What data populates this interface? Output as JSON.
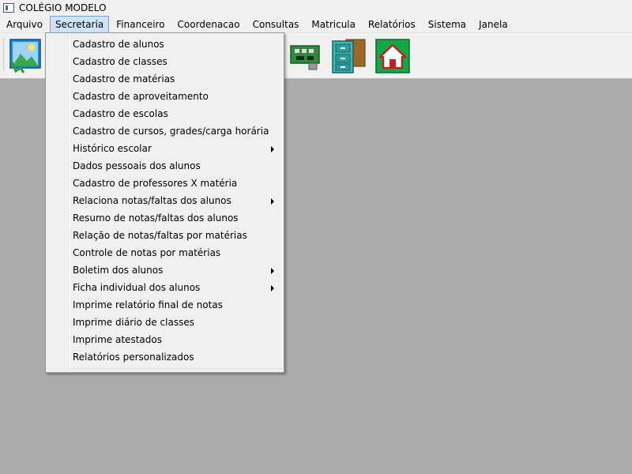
{
  "window": {
    "title": "COLÉGIO MODELO"
  },
  "menubar": {
    "items": [
      {
        "label": "Arquivo"
      },
      {
        "label": "Secretaria",
        "active": true
      },
      {
        "label": "Financeiro"
      },
      {
        "label": "Coordenacao"
      },
      {
        "label": "Consultas"
      },
      {
        "label": "Matricula"
      },
      {
        "label": "Relatórios"
      },
      {
        "label": "Sistema"
      },
      {
        "label": "Janela"
      }
    ]
  },
  "toolbar": {
    "buttons": [
      {
        "icon": "picture-frame-icon"
      },
      {
        "icon": "circuit-board-icon"
      },
      {
        "icon": "file-cabinet-icon"
      },
      {
        "icon": "home-icon"
      }
    ]
  },
  "secretaria_menu": {
    "items": [
      {
        "label": "Cadastro de alunos"
      },
      {
        "label": "Cadastro de classes"
      },
      {
        "label": "Cadastro de matérias"
      },
      {
        "label": "Cadastro de aproveitamento"
      },
      {
        "label": "Cadastro de escolas"
      },
      {
        "label": "Cadastro de cursos, grades/carga horária"
      },
      {
        "label": "Histórico escolar",
        "submenu": true
      },
      {
        "label": "Dados pessoais dos alunos"
      },
      {
        "label": "Cadastro de professores X matéria"
      },
      {
        "label": "Relaciona notas/faltas dos alunos",
        "submenu": true
      },
      {
        "label": "Resumo de notas/faltas dos alunos"
      },
      {
        "label": "Relação de notas/faltas por matérias"
      },
      {
        "label": "Controle de notas por matérias"
      },
      {
        "label": "Boletim dos alunos",
        "submenu": true
      },
      {
        "label": "Ficha individual dos alunos",
        "submenu": true
      },
      {
        "label": "Imprime relatório final de notas"
      },
      {
        "label": "Imprime diário de classes"
      },
      {
        "label": "Imprime atestados"
      },
      {
        "label": "Relatórios personalizados"
      }
    ]
  }
}
